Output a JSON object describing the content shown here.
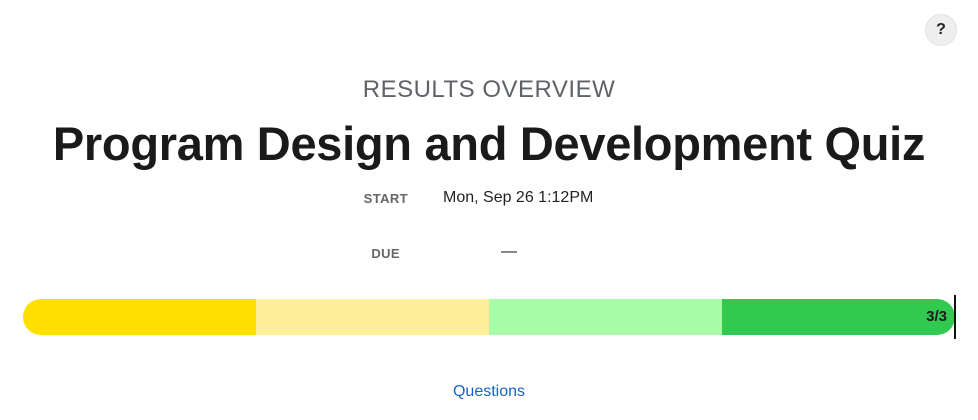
{
  "help": {
    "label": "?"
  },
  "header": {
    "overline": "RESULTS OVERVIEW",
    "title": "Program Design and Development Quiz"
  },
  "meta": {
    "start_label": "START",
    "start_value": "Mon, Sep 26 1:12PM",
    "due_label": "DUE",
    "due_value": "—"
  },
  "progress": {
    "count_label": "3/3",
    "segments": [
      {
        "color": "#ffdf00"
      },
      {
        "color": "#ffee99"
      },
      {
        "color": "#a8fca8"
      },
      {
        "color": "#31c950"
      }
    ]
  },
  "footer": {
    "questions_link": "Questions"
  }
}
